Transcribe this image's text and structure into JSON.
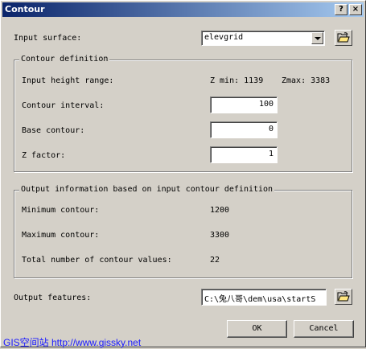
{
  "window": {
    "title": "Contour",
    "help_glyph": "?",
    "close_glyph": "×"
  },
  "input_surface": {
    "label": "Input surface:",
    "value": "elevgrid"
  },
  "contour_definition": {
    "legend": "Contour definition",
    "height_range_label": "Input height range:",
    "zmin_text": "Z min: 1139",
    "zmax_text": "Zmax: 3383",
    "interval_label": "Contour interval:",
    "interval_value": "100",
    "base_label": "Base contour:",
    "base_value": "0",
    "zfactor_label": "Z factor:",
    "zfactor_value": "1"
  },
  "output_info": {
    "legend": "Output information based on input contour definition",
    "min_label": "Minimum contour:",
    "min_value": "1200",
    "max_label": "Maximum contour:",
    "max_value": "3300",
    "total_label": "Total number of contour values:",
    "total_value": "22"
  },
  "output_features": {
    "label": "Output features:",
    "value": "C:\\兔八哥\\dem\\usa\\startS"
  },
  "buttons": {
    "ok": "OK",
    "cancel": "Cancel"
  },
  "watermark": "GIS空间站   http://www.gissky.net",
  "colors": {
    "title_start": "#0a246a",
    "title_end": "#a6caf0",
    "face": "#d4d0c8",
    "watermark": "#1a1aff"
  },
  "icons": {
    "browse": "folder-open-icon",
    "dropdown": "chevron-down-icon"
  }
}
